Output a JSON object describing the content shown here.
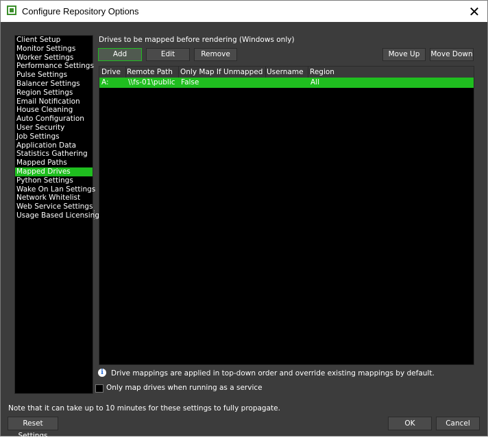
{
  "window": {
    "title": "Configure Repository Options",
    "close_glyph": "✕"
  },
  "sidebar": {
    "active_index": 15,
    "items": [
      {
        "label": "Client Setup"
      },
      {
        "label": "Monitor Settings"
      },
      {
        "label": "Worker Settings"
      },
      {
        "label": "Performance Settings"
      },
      {
        "label": "Pulse Settings"
      },
      {
        "label": "Balancer Settings"
      },
      {
        "label": "Region Settings"
      },
      {
        "label": "Email Notification"
      },
      {
        "label": "House Cleaning"
      },
      {
        "label": "Auto Configuration"
      },
      {
        "label": "User Security"
      },
      {
        "label": "Job Settings"
      },
      {
        "label": "Application Data"
      },
      {
        "label": "Statistics Gathering"
      },
      {
        "label": "Mapped Paths"
      },
      {
        "label": "Mapped Drives"
      },
      {
        "label": "Python Settings"
      },
      {
        "label": "Wake On Lan Settings"
      },
      {
        "label": "Network Whitelist"
      },
      {
        "label": "Web Service Settings"
      },
      {
        "label": "Usage Based Licensing"
      }
    ]
  },
  "main": {
    "section_label": "Drives to be mapped before rendering (Windows only)",
    "toolbar": {
      "add_label": "Add",
      "edit_label": "Edit",
      "remove_label": "Remove",
      "move_up_label": "Move Up",
      "move_down_label": "Move Down"
    },
    "table": {
      "columns": [
        "Drive",
        "Remote Path",
        "Only Map If Unmapped",
        "Username",
        "Region"
      ],
      "rows": [
        {
          "cells": [
            "A:",
            "\\\\fs-01\\public",
            "False",
            "",
            "All"
          ],
          "selected": true
        }
      ]
    },
    "info_text": "Drive mappings are applied in top-down order and override existing mappings by default.",
    "info_icon": "info-icon",
    "checkbox_label": "Only map drives when running as a service",
    "checkbox_checked": false
  },
  "footer": {
    "note": "Note that it can take up to 10 minutes for these settings to fully propagate.",
    "reset_label": "Reset Settings",
    "ok_label": "OK",
    "cancel_label": "Cancel"
  },
  "colors": {
    "accent": "#1fbe1f",
    "background": "#3c3c3c",
    "panel": "#000000"
  }
}
